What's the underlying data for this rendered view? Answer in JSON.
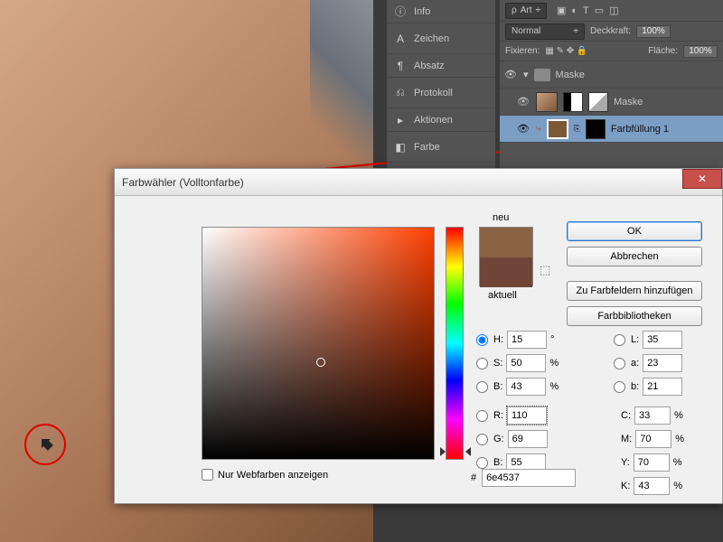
{
  "panels": {
    "info": "Info",
    "zeichen": "Zeichen",
    "absatz": "Absatz",
    "protokoll": "Protokoll",
    "aktionen": "Aktionen",
    "farbe": "Farbe"
  },
  "layers": {
    "kind_label": "Art",
    "blend": "Normal",
    "opacity_label": "Deckkraft:",
    "opacity_value": "100%",
    "lock_label": "Fixieren:",
    "fill_label": "Fläche:",
    "fill_value": "100%",
    "group": "Maske",
    "layer_mask": "Maske",
    "layer_fill": "Farbfüllung 1"
  },
  "dialog": {
    "title": "Farbwähler (Volltonfarbe)",
    "new_label": "neu",
    "current_label": "aktuell",
    "ok": "OK",
    "cancel": "Abbrechen",
    "add": "Zu Farbfeldern hinzufügen",
    "lib": "Farbbibliotheken",
    "webonly": "Nur Webfarben anzeigen",
    "hex_prefix": "#",
    "hex": "6e4537",
    "H": "15",
    "H_unit": "°",
    "S": "50",
    "S_unit": "%",
    "Bval": "43",
    "B_unit": "%",
    "R": "110",
    "G": "69",
    "Bch": "55",
    "L": "35",
    "a": "23",
    "bLab": "21",
    "C": "33",
    "M": "70",
    "Y": "70",
    "K": "43",
    "pct": "%",
    "lbl_H": "H:",
    "lbl_S": "S:",
    "lbl_B": "B:",
    "lbl_R": "R:",
    "lbl_G": "G:",
    "lbl_L": "L:",
    "lbl_a": "a:",
    "lbl_b": "b:",
    "lbl_C": "C:",
    "lbl_M": "M:",
    "lbl_Y": "Y:",
    "lbl_K": "K:"
  }
}
